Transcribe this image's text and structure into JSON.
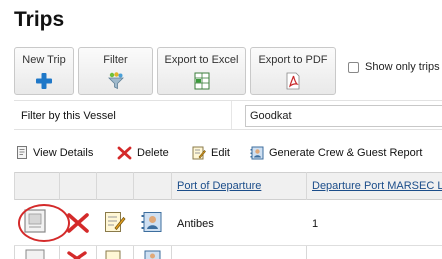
{
  "page": {
    "title": "Trips"
  },
  "toolbar": {
    "new_trip": "New Trip",
    "filter": "Filter",
    "export_excel": "Export to Excel",
    "export_pdf": "Export to PDF"
  },
  "show_only": {
    "label": "Show only trips",
    "checked": false
  },
  "vessel_filter": {
    "label": "Filter by this Vessel",
    "value": "Goodkat"
  },
  "actions": {
    "view_details": "View Details",
    "delete": "Delete",
    "edit": "Edit",
    "report": "Generate Crew & Guest Report"
  },
  "grid": {
    "columns": [
      "Port of Departure",
      "Departure Port MARSEC L"
    ],
    "rows": [
      {
        "port_of_departure": "Antibes",
        "marsec_level": "1"
      }
    ]
  },
  "colors": {
    "accent_red": "#d42a2a",
    "link_blue": "#1b4d8a",
    "plus_blue": "#1f78c8"
  }
}
